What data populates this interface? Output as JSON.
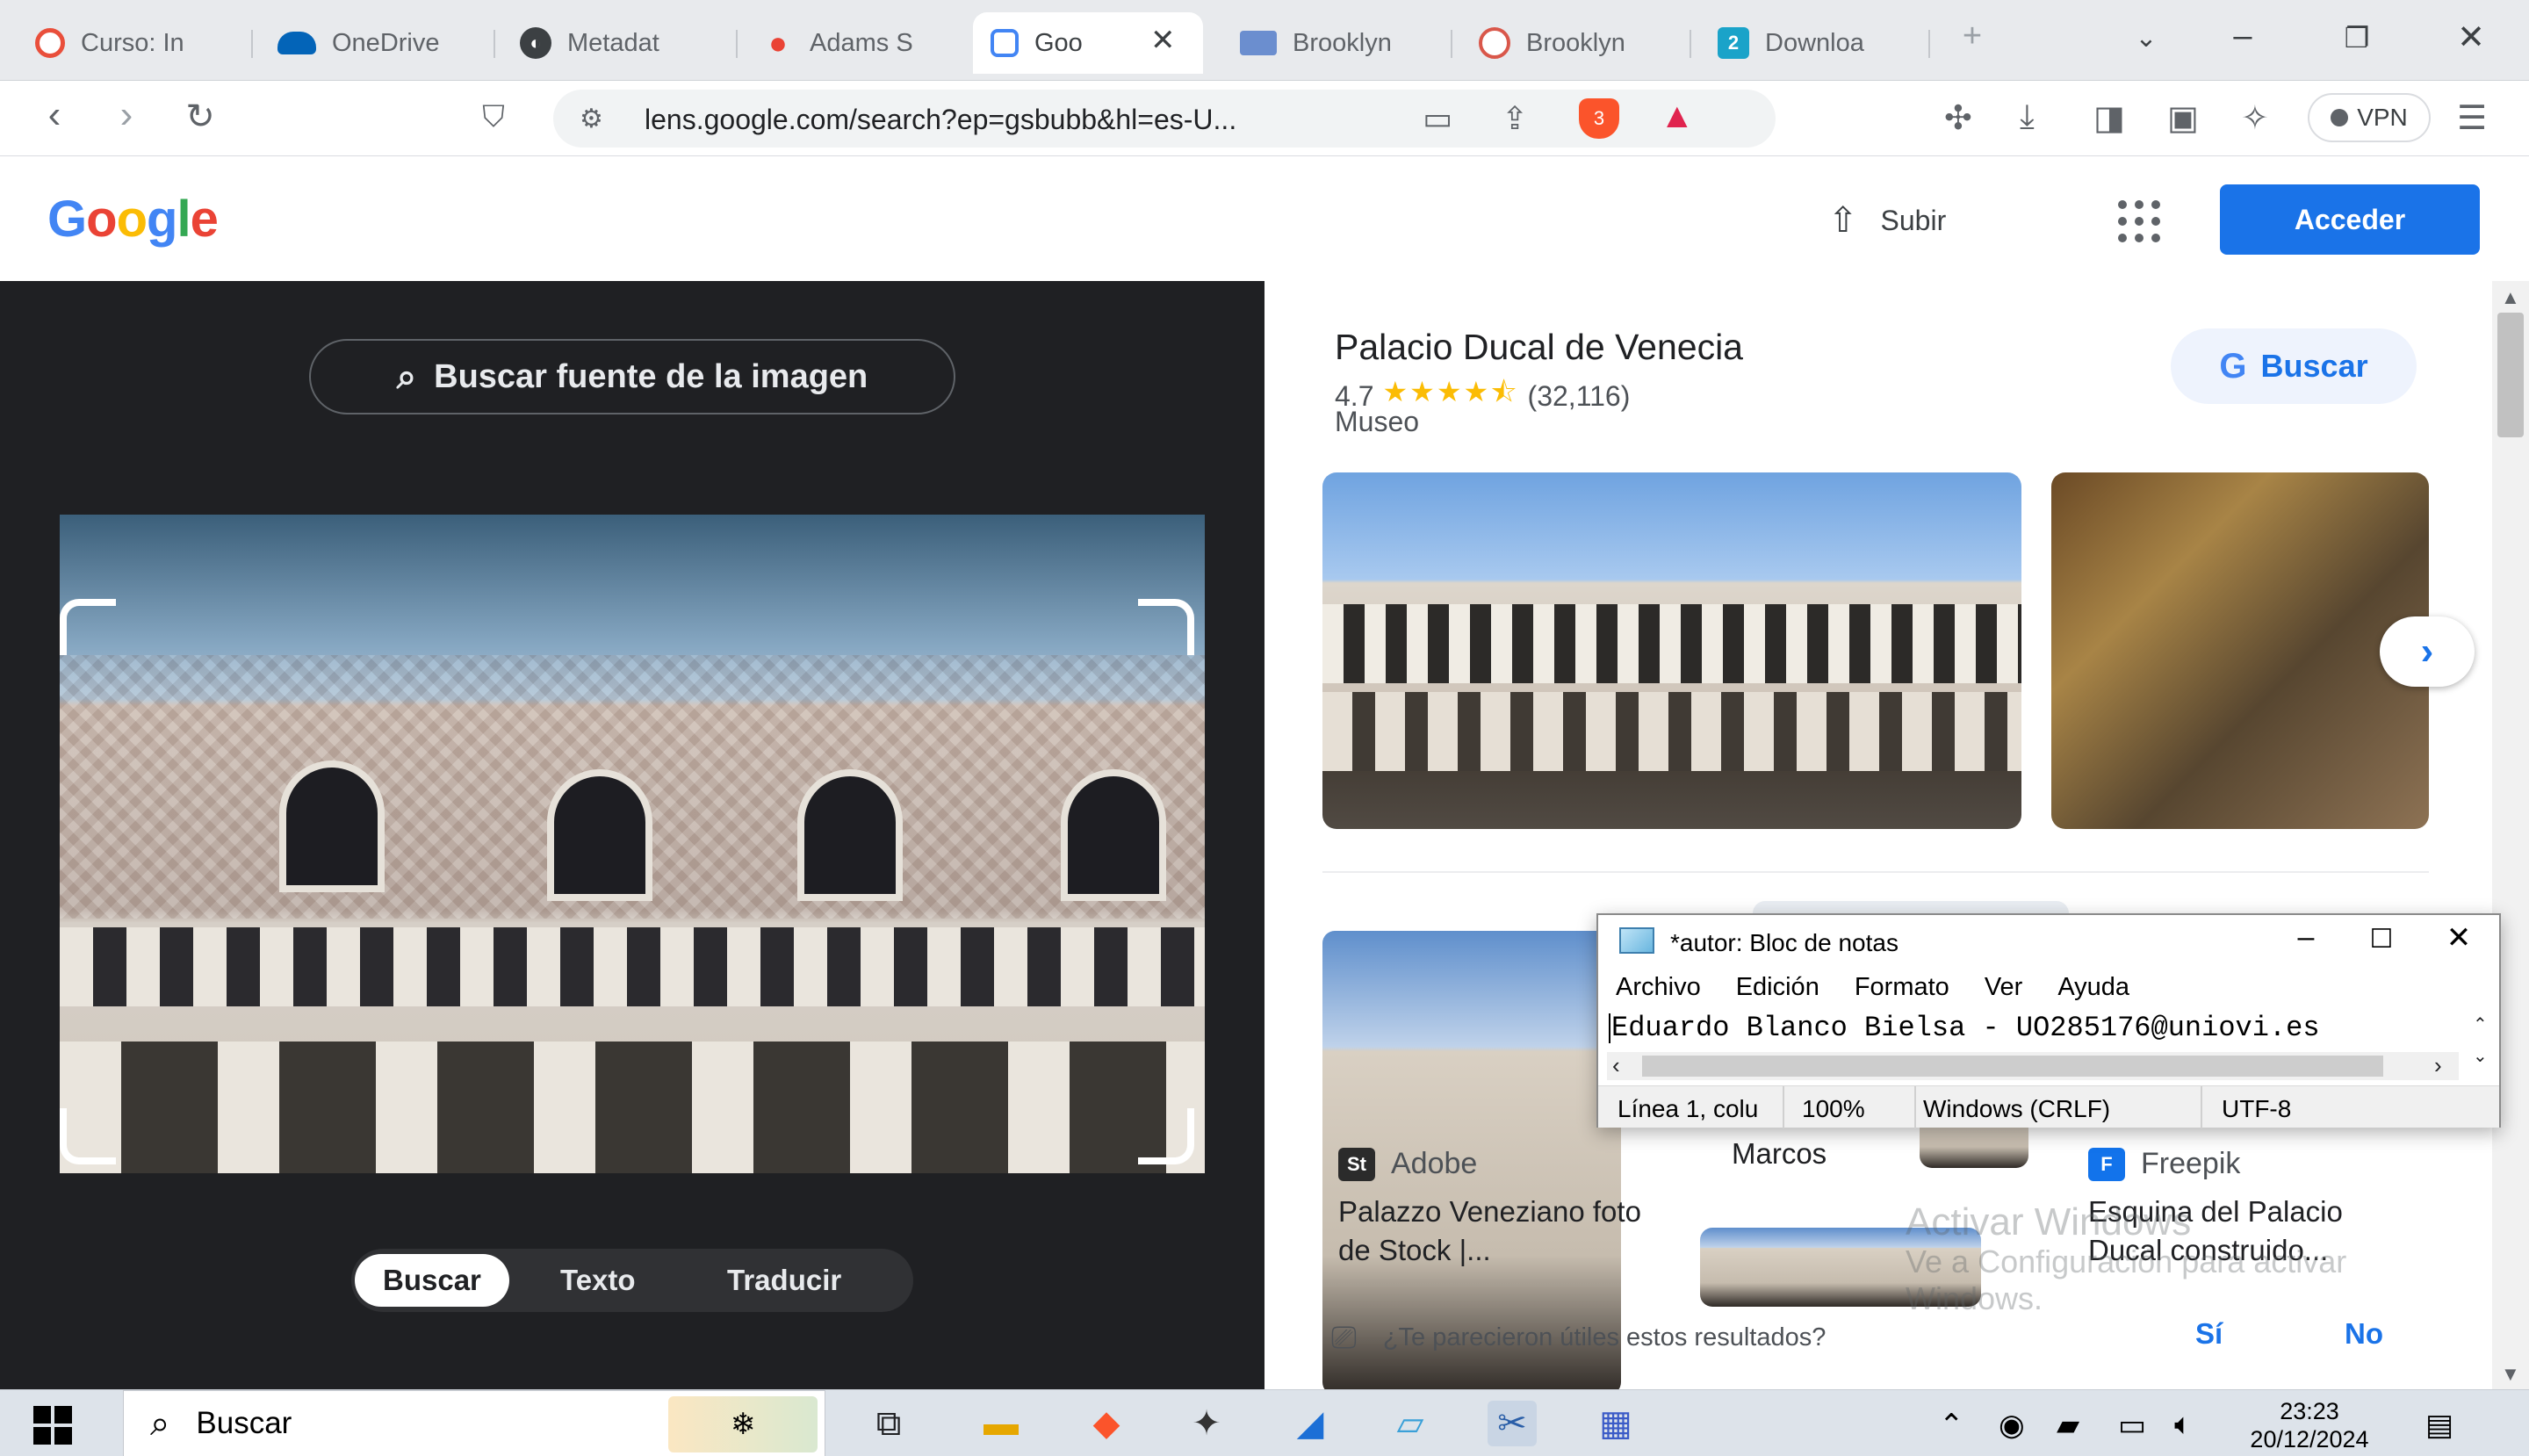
{
  "browser": {
    "tabs": [
      {
        "label": "Curso: In",
        "active": false
      },
      {
        "label": "OneDrive",
        "active": false
      },
      {
        "label": "Metadat",
        "active": false
      },
      {
        "label": "Adams S",
        "active": false
      },
      {
        "label": "Goo",
        "active": true
      },
      {
        "label": "Brooklyn",
        "active": false
      },
      {
        "label": "Brooklyn",
        "active": false
      },
      {
        "label": "Downloa",
        "active": false
      }
    ],
    "new_tab": "+",
    "url": "lens.google.com/search?ep=gsbubb&hl=es-U...",
    "vpn_label": "VPN",
    "shield_count": "3"
  },
  "google": {
    "logo": [
      "G",
      "o",
      "o",
      "g",
      "l",
      "e"
    ],
    "logo_colors": [
      "#4285F4",
      "#EA4335",
      "#FBBC05",
      "#4285F4",
      "#34A853",
      "#EA4335"
    ],
    "upload_label": "Subir",
    "signin_label": "Acceder",
    "accent": "#1a73e8"
  },
  "lens": {
    "source_button": "Buscar fuente de la imagen",
    "tabs": [
      "Buscar",
      "Texto",
      "Traducir"
    ],
    "active_tab": "Buscar"
  },
  "knowledge_panel": {
    "title": "Palacio Ducal de Venecia",
    "rating": "4.7",
    "stars": "★★★★⯪",
    "reviews": "(32,116)",
    "type": "Museo",
    "search_chip": "Buscar",
    "search_chip_mark": "G"
  },
  "results": [
    {
      "source": "Adobe",
      "title": "Palazzo Veneziano foto de Stock |..."
    },
    {
      "source": "",
      "title": "Marcos"
    },
    {
      "source": "Freepik",
      "title": "Esquina del Palacio Ducal construido..."
    }
  ],
  "result_logos": [
    "St",
    "F"
  ],
  "feedback": {
    "question": "¿Te parecieron útiles estos resultados?",
    "yes": "Sí",
    "no": "No"
  },
  "watermark": {
    "line1": "Activar Windows",
    "line2": "Ve a Configuración para activar",
    "line3": "Windows."
  },
  "notepad": {
    "title": "*autor: Bloc de notas",
    "menu": [
      "Archivo",
      "Edición",
      "Formato",
      "Ver",
      "Ayuda"
    ],
    "content": "Eduardo Blanco Bielsa - UO285176@uniovi.es",
    "status": {
      "position": "Línea 1, colu",
      "zoom": "100%",
      "line_endings": "Windows (CRLF)",
      "encoding": "UTF-8"
    }
  },
  "taskbar": {
    "search_label": "Buscar",
    "time": "23:23",
    "date": "20/12/2024"
  },
  "icons": {
    "back": "chevron-left-icon",
    "forward": "chevron-right-icon",
    "reload": "reload-icon",
    "bookmark": "bookmark-icon",
    "upload": "upload-icon",
    "apps": "apps-grid-icon",
    "lens_search": "lens-search-icon"
  }
}
